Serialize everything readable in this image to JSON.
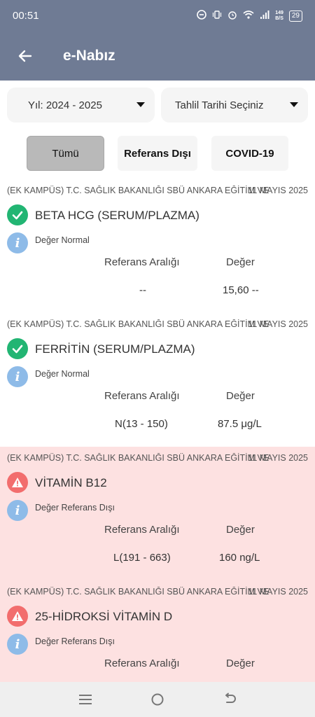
{
  "status_bar": {
    "time": "00:51",
    "speed_top": "149",
    "speed_unit": "B/S",
    "battery": "29"
  },
  "app_bar": {
    "title": "e-Nabız"
  },
  "filters": {
    "year": "Yıl: 2024 - 2025",
    "date": "Tahlil Tarihi Seçiniz"
  },
  "tabs": [
    {
      "label": "Tümü",
      "active": true
    },
    {
      "label": "Referans Dışı"
    },
    {
      "label": "COVID-19"
    }
  ],
  "columns": {
    "range": "Referans Aralığı",
    "value": "Değer"
  },
  "colors": {
    "header": "#6f7b94",
    "normal": "#22b573",
    "out_of_range": "#f26d6d",
    "out_bg": "#fde1e1"
  },
  "results": [
    {
      "org": "(EK KAMPÜS) T.C. SAĞLIK BAKANLIĞI SBÜ ANKARA EĞİTİM VE",
      "date": "11 MAYIS 2025",
      "name": "BETA HCG (SERUM/PLAZMA)",
      "status": "Değer Normal",
      "range": "--",
      "value": "15,60 --",
      "out": false
    },
    {
      "org": "(EK KAMPÜS) T.C. SAĞLIK BAKANLIĞI SBÜ ANKARA EĞİTİM VE",
      "date": "11 MAYIS 2025",
      "name": "FERRİTİN (SERUM/PLAZMA)",
      "status": "Değer Normal",
      "range": "N(13 - 150)",
      "value": "87.5 μg/L",
      "out": false
    },
    {
      "org": "(EK KAMPÜS) T.C. SAĞLIK BAKANLIĞI SBÜ ANKARA EĞİTİM VE",
      "date": "11 MAYIS 2025",
      "name": "VİTAMİN B12",
      "status": "Değer Referans Dışı",
      "range": "L(191 - 663)",
      "value": "160 ng/L",
      "out": true
    },
    {
      "org": "(EK KAMPÜS) T.C. SAĞLIK BAKANLIĞI SBÜ ANKARA EĞİTİM VE",
      "date": "11 MAYIS 2025",
      "name": "25-HİDROKSİ VİTAMİN D",
      "status": "Değer Referans Dışı",
      "range": "",
      "value": "",
      "out": true
    }
  ]
}
